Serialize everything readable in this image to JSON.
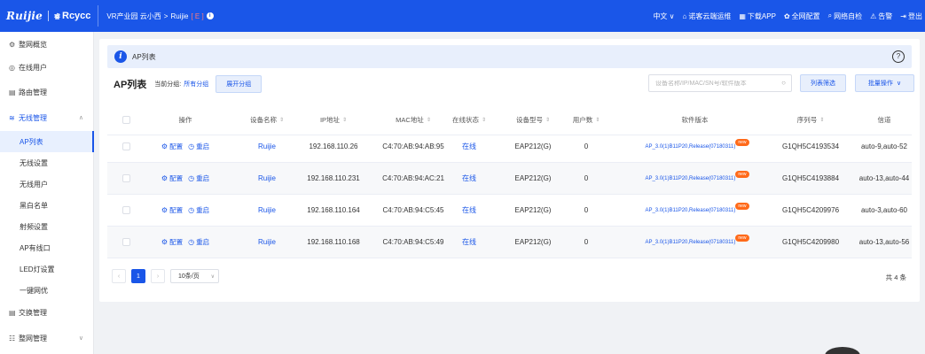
{
  "topbar": {
    "logo_text": "Ruijie",
    "brand_text": "Rcycc",
    "brand_mark": "睿",
    "breadcrumb": [
      "VR产业园 云小西",
      "Ruijie"
    ],
    "breadcrumb_sep": ">",
    "breadcrumb_tag": "[ E ]",
    "info_icon": "i",
    "right_items": [
      {
        "icon": "",
        "label": "中文 ∨"
      },
      {
        "icon": "⌂",
        "label": "诺客云端运维"
      },
      {
        "icon": "▦",
        "label": "下载APP"
      },
      {
        "icon": "✿",
        "label": "全网配置"
      },
      {
        "icon": "⌕",
        "label": "网络自检"
      },
      {
        "icon": "⚠",
        "label": "告警"
      },
      {
        "icon": "⇥",
        "label": "登出"
      }
    ]
  },
  "sidebar": {
    "items": [
      {
        "icon": "⚙",
        "label": "整网概览"
      },
      {
        "icon": "◎",
        "label": "在线用户"
      },
      {
        "icon": "▤",
        "label": "路由管理"
      },
      {
        "icon": "≋",
        "label": "无线管理",
        "chev": "∧"
      },
      {
        "label": "AP列表"
      },
      {
        "label": "无线设置"
      },
      {
        "label": "无线用户"
      },
      {
        "label": "黑白名单"
      },
      {
        "label": "射频设置"
      },
      {
        "label": "AP有线口"
      },
      {
        "label": "LED灯设置"
      },
      {
        "label": "一键网优"
      },
      {
        "icon": "▤",
        "label": "交换管理"
      },
      {
        "icon": "☷",
        "label": "整网管理",
        "chev": "∨"
      }
    ]
  },
  "info_bar": {
    "icon": "i",
    "title": "AP列表",
    "help": "?"
  },
  "toolbar": {
    "title": "AP列表",
    "group_label": "当前分组:",
    "group_value": "所有分组",
    "expand_label": "展开分组",
    "search_placeholder": "设备名称/IP/MAC/SN号/软件版本",
    "search_icon": "○",
    "filter_label": "列表筛选",
    "batch_label": "批量操作",
    "batch_chev": "∨"
  },
  "table": {
    "sort_icon": "⇕",
    "headers": [
      "操作",
      "设备名称",
      "IP地址",
      "MAC地址",
      "在线状态",
      "设备型号",
      "用户数",
      "软件版本",
      "序列号",
      "信道"
    ],
    "op_config": "配置",
    "op_restart": "重启",
    "op_config_icon": "⚙",
    "op_restart_icon": "◷",
    "new_badge": "new",
    "rows": [
      {
        "name": "Ruijie",
        "ip": "192.168.110.26",
        "mac": "C4:70:AB:94:AB:95",
        "status": "在线",
        "model": "EAP212(G)",
        "users": "0",
        "version": "AP_3.0(1)B11P20,Release(07180311)",
        "sn": "G1QH5C4193534",
        "channel": "auto-9,auto-52"
      },
      {
        "name": "Ruijie",
        "ip": "192.168.110.231",
        "mac": "C4:70:AB:94:AC:21",
        "status": "在线",
        "model": "EAP212(G)",
        "users": "0",
        "version": "AP_3.0(1)B11P20,Release(07180311)",
        "sn": "G1QH5C4193884",
        "channel": "auto-13,auto-44"
      },
      {
        "name": "Ruijie",
        "ip": "192.168.110.164",
        "mac": "C4:70:AB:94:C5:45",
        "status": "在线",
        "model": "EAP212(G)",
        "users": "0",
        "version": "AP_3.0(1)B11P20,Release(07180311)",
        "sn": "G1QH5C4209976",
        "channel": "auto-3,auto-60"
      },
      {
        "name": "Ruijie",
        "ip": "192.168.110.168",
        "mac": "C4:70:AB:94:C5:49",
        "status": "在线",
        "model": "EAP212(G)",
        "users": "0",
        "version": "AP_3.0(1)B11P20,Release(07180311)",
        "sn": "G1QH5C4209980",
        "channel": "auto-13,auto-56"
      }
    ]
  },
  "pagination": {
    "prev": "‹",
    "current": "1",
    "next": "›",
    "page_size": "10条/页",
    "page_size_chev": "∨",
    "total": "共 4 条"
  },
  "colors": {
    "primary": "#1a56e8",
    "badge": "#ff6a1a",
    "info_bg": "#e8effc"
  }
}
